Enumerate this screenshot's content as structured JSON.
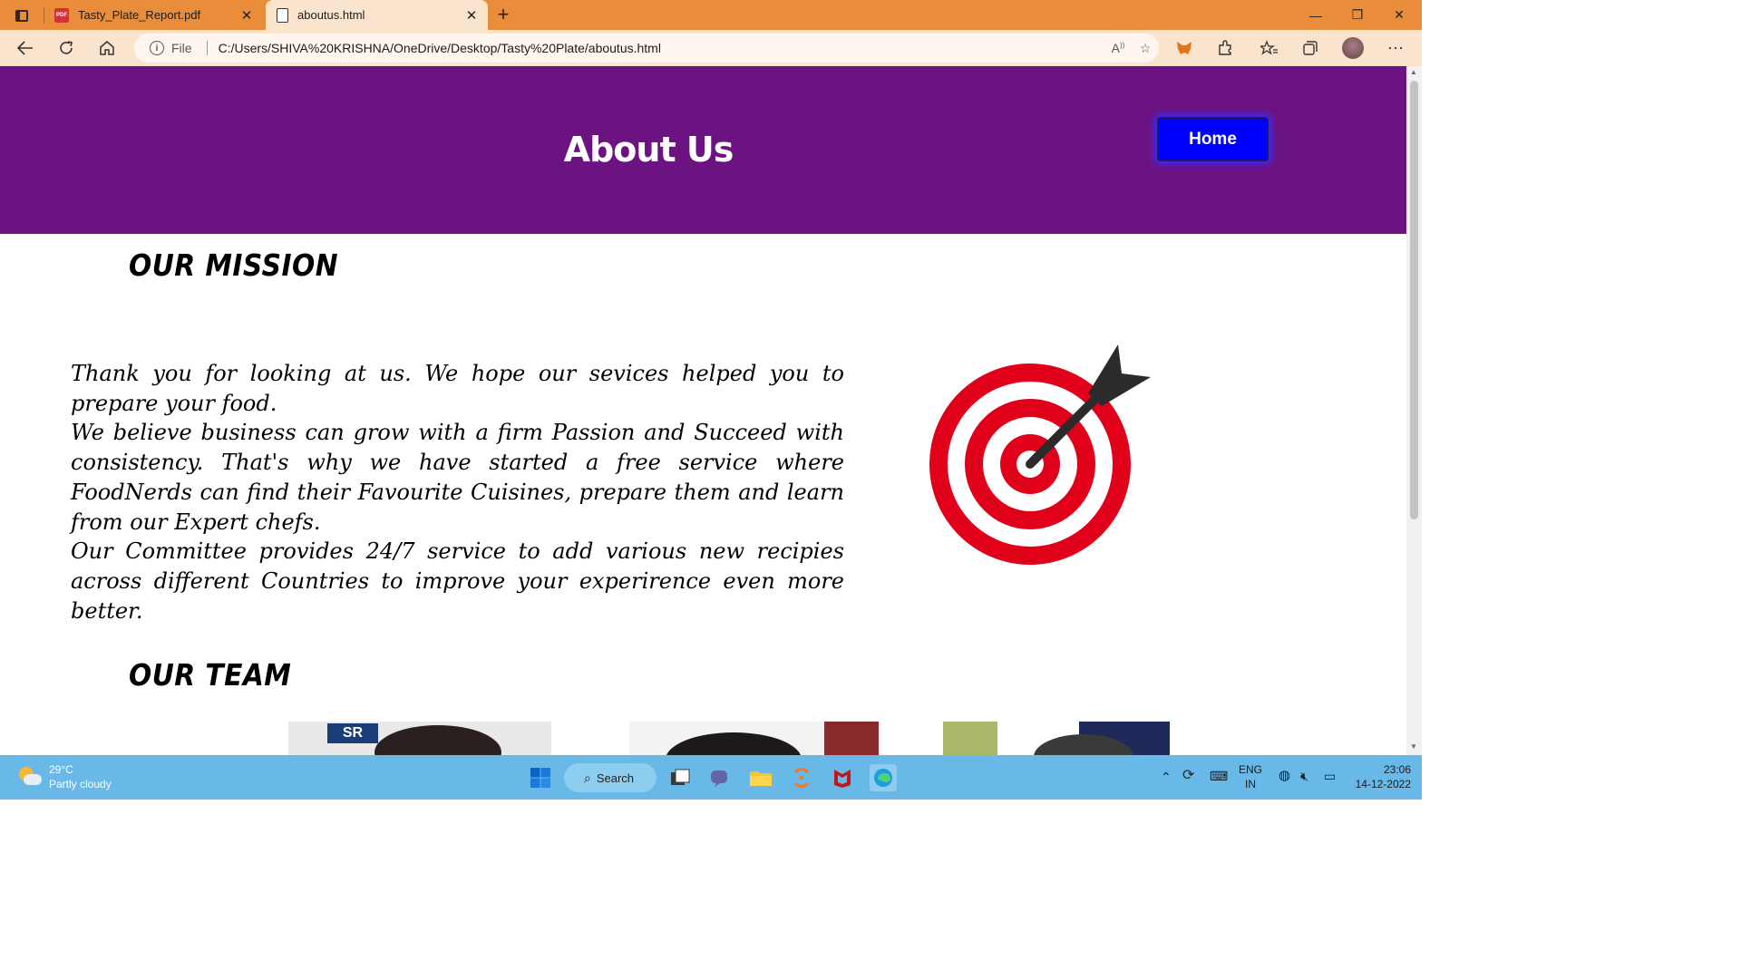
{
  "browser": {
    "tabs": [
      {
        "title": "Tasty_Plate_Report.pdf",
        "icon": "pdf-file-icon",
        "active": false
      },
      {
        "title": "aboutus.html",
        "icon": "page-icon",
        "active": true
      }
    ],
    "address": {
      "scheme_label": "File",
      "url": "C:/Users/SHIVA%20KRISHNA/OneDrive/Desktop/Tasty%20Plate/aboutus.html"
    },
    "colors": {
      "chrome": "#ea8d3a",
      "toolbar": "#fbe4cd"
    }
  },
  "page": {
    "title": "About Us",
    "home_button": "Home",
    "mission_heading": "OUR MISSION",
    "mission_paragraphs": [
      "Thank you for looking at us. We hope our sevices helped you to prepare your food.",
      "We believe business can grow with a firm Passion and Succeed with consistency. That's why we have started a free service where FoodNerds can find their Favourite Cuisines, prepare them and learn from our Expert chefs.",
      "Our Committee provides 24/7 service to add various new recipies across different Countries to improve your experirence even more better."
    ],
    "team_heading": "OUR TEAM",
    "colors": {
      "header_bg": "#6c1382",
      "button_bg": "#0000ff",
      "target_red": "#e0001a"
    }
  },
  "taskbar": {
    "weather_temp": "29°C",
    "weather_desc": "Partly cloudy",
    "search_label": "Search",
    "lang_line1": "ENG",
    "lang_line2": "IN",
    "time": "23:06",
    "date": "14-12-2022"
  }
}
